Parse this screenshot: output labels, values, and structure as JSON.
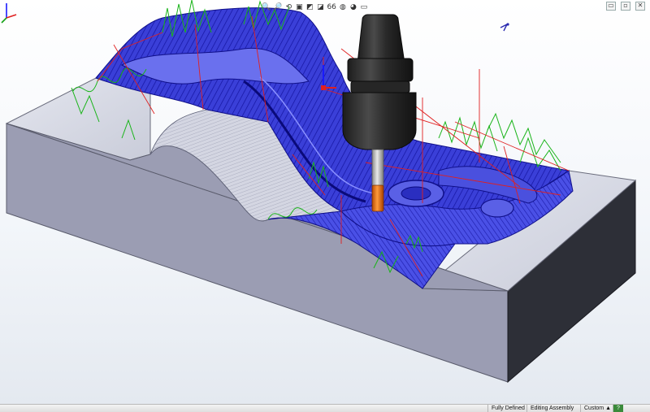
{
  "app": {
    "name": "CAM viewport - 3D toolpath simulation"
  },
  "view_toolbar": {
    "icons": [
      "zoom-fit-icon",
      "zoom-area-icon",
      "previous-view-icon",
      "section-view-icon",
      "view-orientation-icon",
      "display-style-icon",
      "hide-show-icon",
      "edit-appearance-icon",
      "scene-icon",
      "view-settings-icon"
    ],
    "glyphs": [
      "🔍",
      "🔎",
      "⟲",
      "▣",
      "◩",
      "◪",
      "66",
      "◍",
      "◕",
      "▭"
    ]
  },
  "window_controls": {
    "restore": "▭",
    "minimize": "▫",
    "close": "✕"
  },
  "status_bar": {
    "definition": "Fully Defined",
    "mode": "Editing Assembly",
    "units": "Custom",
    "units_arrow": "▲",
    "help": "?"
  },
  "colors": {
    "stock_top": "#d9dbe6",
    "stock_side_front": "#9a9cb1",
    "stock_side_right": "#2d2f37",
    "toolpath": "#2b2bd1",
    "rapid": "#e02020",
    "lead": "#15b515",
    "tool_holder": "#2b2b2b",
    "tool_shank": "#b9b9b9",
    "tool_cutter": "#e86a10"
  }
}
